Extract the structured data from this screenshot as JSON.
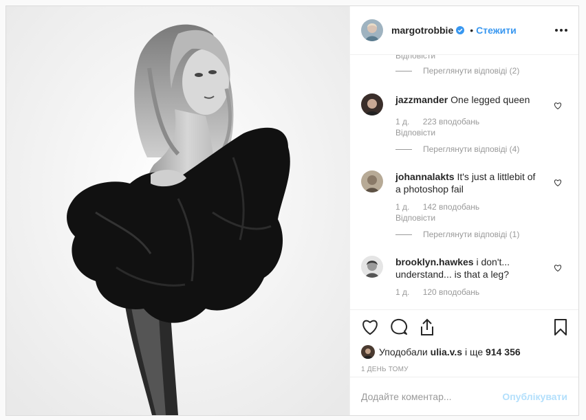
{
  "post": {
    "username": "margotrobbie",
    "dot": "•",
    "follow_label": "Стежити"
  },
  "comments_section": {
    "top_reply_label": "Відповісти",
    "top_view_replies": "Переглянути відповіді (2)",
    "items": [
      {
        "username": "jazzmander",
        "text": "One legged queen",
        "time": "1 д.",
        "likes": "223 вподобань",
        "reply_label": "Відповісти",
        "view_replies": "Переглянути відповіді (4)"
      },
      {
        "username": "johannalakts",
        "text": "It's just a littlebit of a photoshop fail",
        "time": "1 д.",
        "likes": "142 вподобань",
        "reply_label": "Відповісти",
        "view_replies": "Переглянути відповіді (1)"
      },
      {
        "username": "brooklyn.hawkes",
        "text": "i don't... understand... is that a leg?",
        "time": "1 д.",
        "likes": "120 вподобань"
      }
    ]
  },
  "likes_line": {
    "prefix": "Уподобали",
    "user": "ulia.v.s",
    "middle": "і ще",
    "count": "914 356"
  },
  "time_ago": "1 ДЕНЬ ТОМУ",
  "add_comment": {
    "placeholder": "Додайте коментар...",
    "publish_label": "Опублікувати"
  },
  "icons": {
    "heart": "heart-icon",
    "comment": "comment-icon",
    "share": "share-icon",
    "bookmark": "bookmark-icon",
    "verified": "verified-badge-icon",
    "more": "more-options-icon"
  },
  "colors": {
    "link_blue": "#3897f0",
    "verified_blue": "#3897f0",
    "muted_text": "#999999",
    "disabled_publish": "#b2dffc"
  }
}
